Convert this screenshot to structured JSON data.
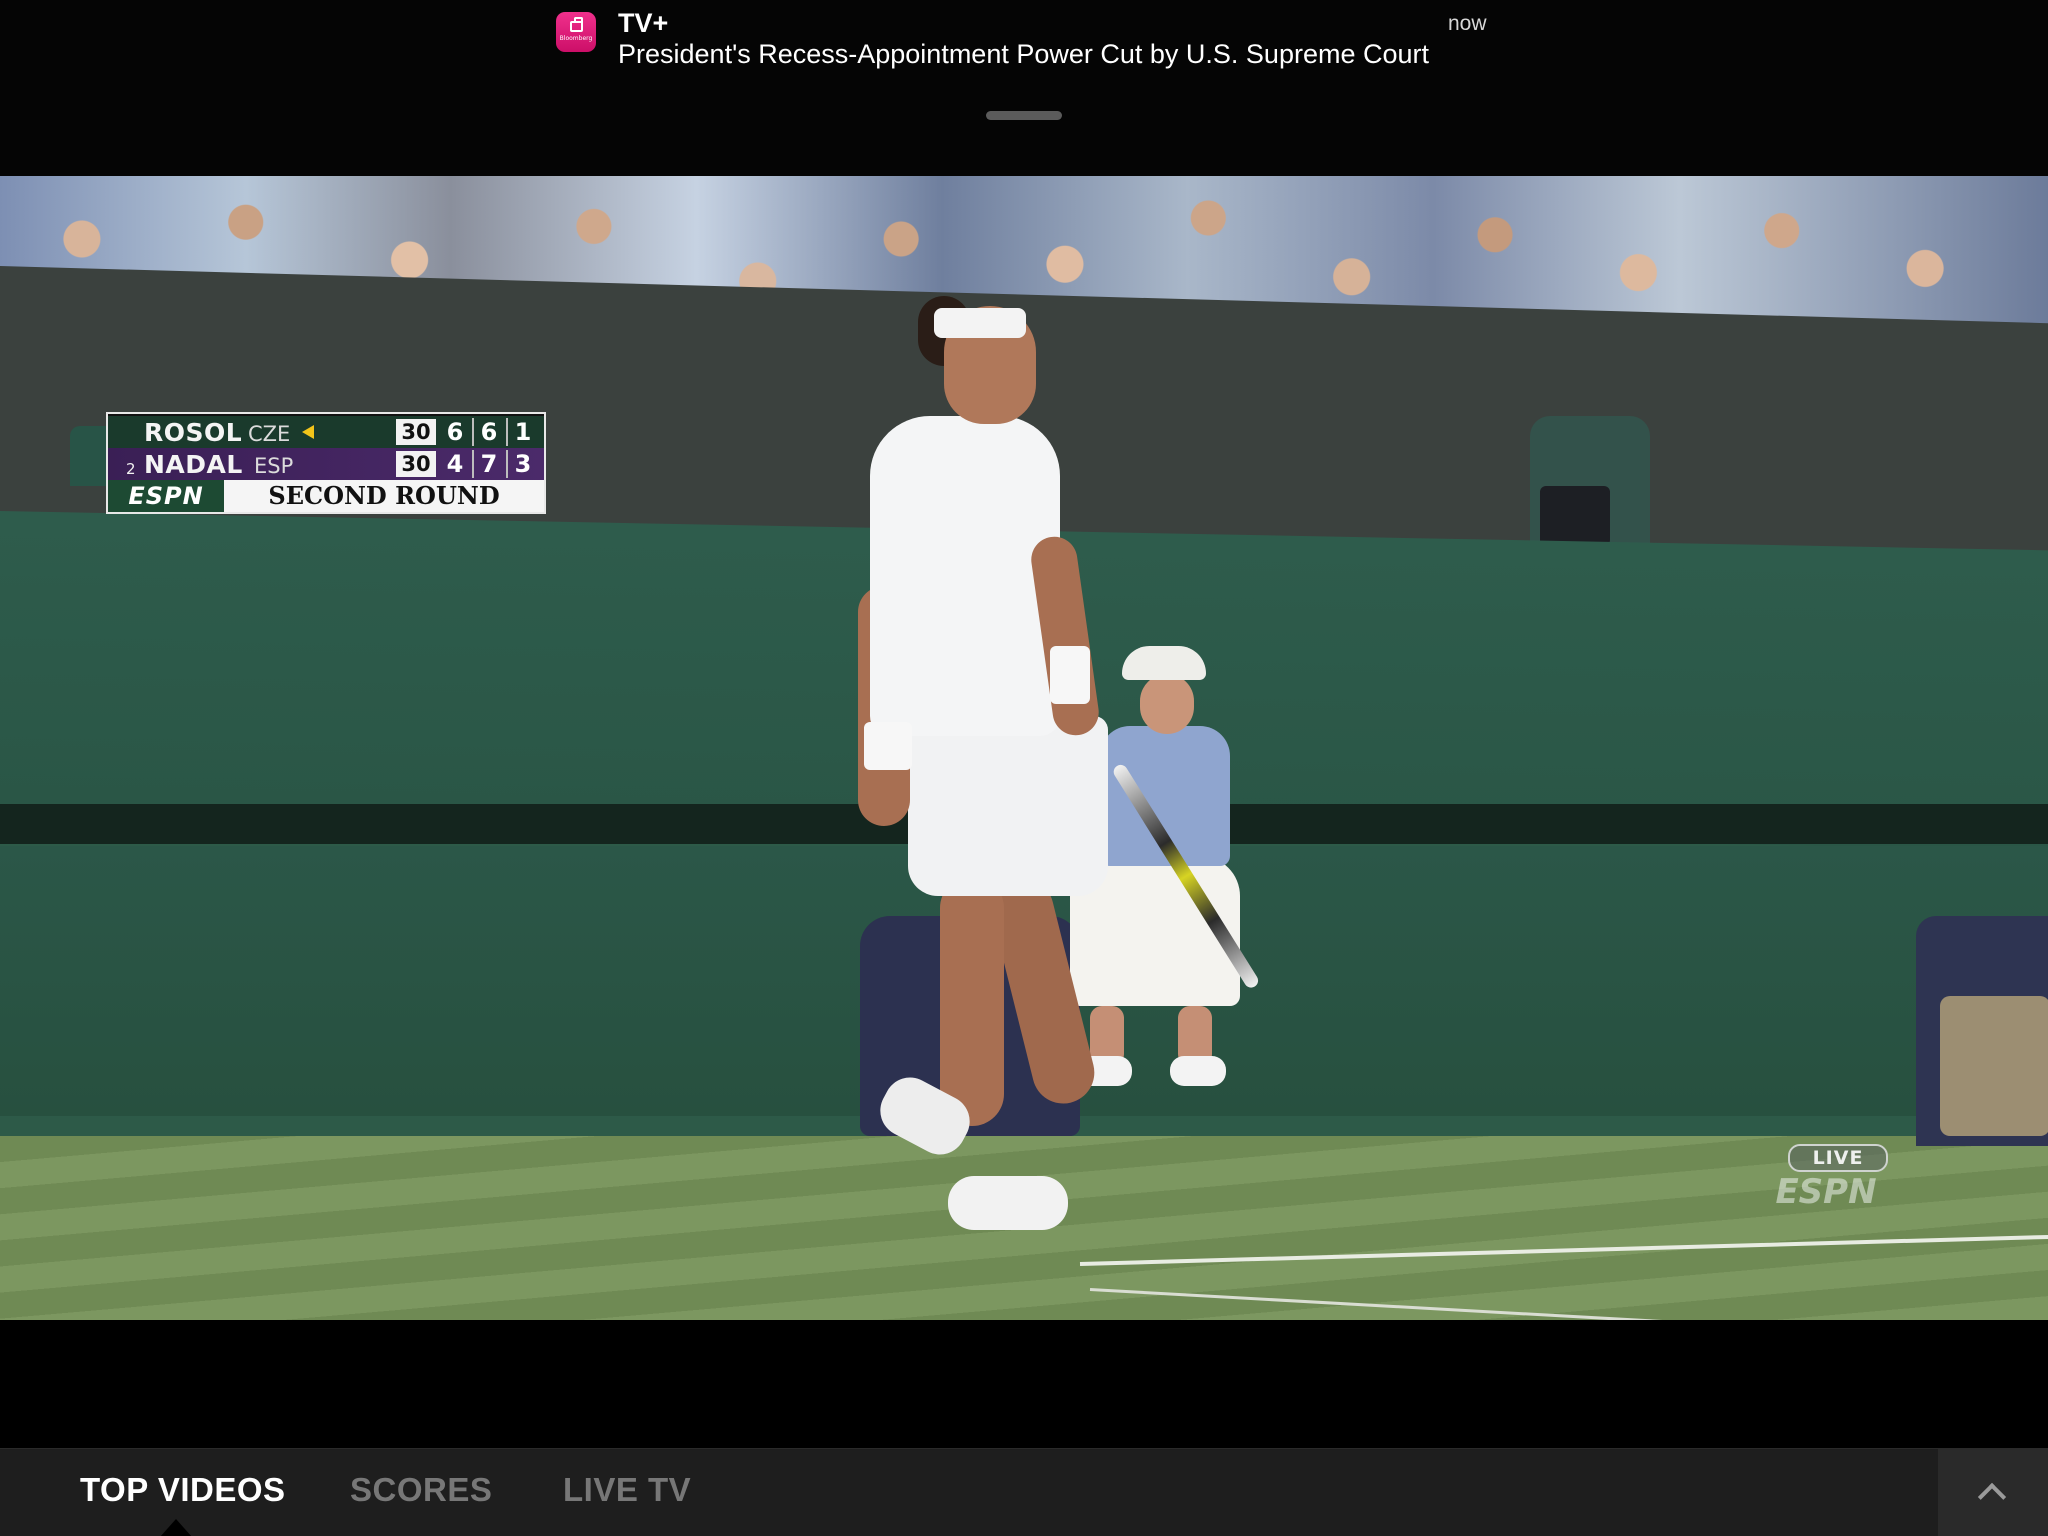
{
  "notification": {
    "app_icon": "bloomberg-app-icon",
    "app_icon_brand": "Bloomberg",
    "app_name": "TV+",
    "time": "now",
    "message": "President's Recess-Appointment Power Cut by U.S. Supreme Court"
  },
  "video": {
    "scorebug": {
      "players": [
        {
          "seed": "",
          "name": "ROSOL",
          "country": "CZE",
          "serving": true,
          "points": "30",
          "sets": [
            "6",
            "6",
            "1"
          ]
        },
        {
          "seed": "2",
          "name": "NADAL",
          "country": "ESP",
          "serving": false,
          "points": "30",
          "sets": [
            "4",
            "7",
            "3"
          ]
        }
      ],
      "network": "ESPN",
      "round": "SECOND ROUND"
    },
    "live_badge": "LIVE",
    "live_network": "ESPN"
  },
  "tabbar": {
    "tabs": [
      {
        "label": "TOP VIDEOS",
        "active": true
      },
      {
        "label": "SCORES",
        "active": false
      },
      {
        "label": "LIVE TV",
        "active": false
      }
    ],
    "expand_icon": "chevron-up-icon"
  },
  "colors": {
    "notification_bg": "#050505",
    "app_icon": "#e0207a",
    "tabbar_bg": "#1e1e1e",
    "tab_active": "#ffffff",
    "tab_inactive": "#777777",
    "serve_indicator": "#f3c41a",
    "scorebug_top": "#1a3a2c",
    "scorebug_bottom": "#4b2a6a"
  }
}
